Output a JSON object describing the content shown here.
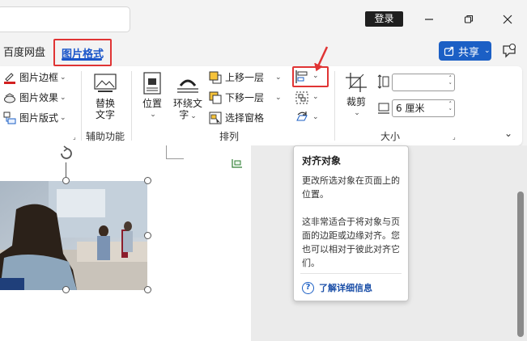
{
  "titlebar": {
    "login_label": "登录",
    "minimize_icon": "minimize-icon",
    "restore_icon": "restore-icon",
    "close_icon": "close-icon"
  },
  "tabs": {
    "baidu": "百度网盘",
    "picture_format": "图片格式",
    "share_label": "共享"
  },
  "ribbon": {
    "border_label": "图片边框",
    "effects_label": "图片效果",
    "layout_label": "图片版式",
    "alt_text_line1": "替换",
    "alt_text_line2": "文字",
    "alt_group": "辅助功能",
    "position_label": "位置",
    "wrap_line1": "环绕文",
    "wrap_line2": "字",
    "bring_forward": "上移一层",
    "send_backward": "下移一层",
    "selection_pane": "选择窗格",
    "arrange_group": "排列",
    "crop_label": "裁剪",
    "height_value": "",
    "width_value": "6 厘米",
    "size_group": "大小"
  },
  "tooltip": {
    "title": "对齐对象",
    "para1": "更改所选对象在页面上的位置。",
    "para2": "这非常适合于将对象与页面的边距或边缘对齐。您也可以相对于彼此对齐它们。",
    "link": "了解详细信息"
  },
  "colors": {
    "accent": "#1a55c9",
    "highlight_red": "#e03434",
    "share_bg": "#1b5fc5"
  }
}
